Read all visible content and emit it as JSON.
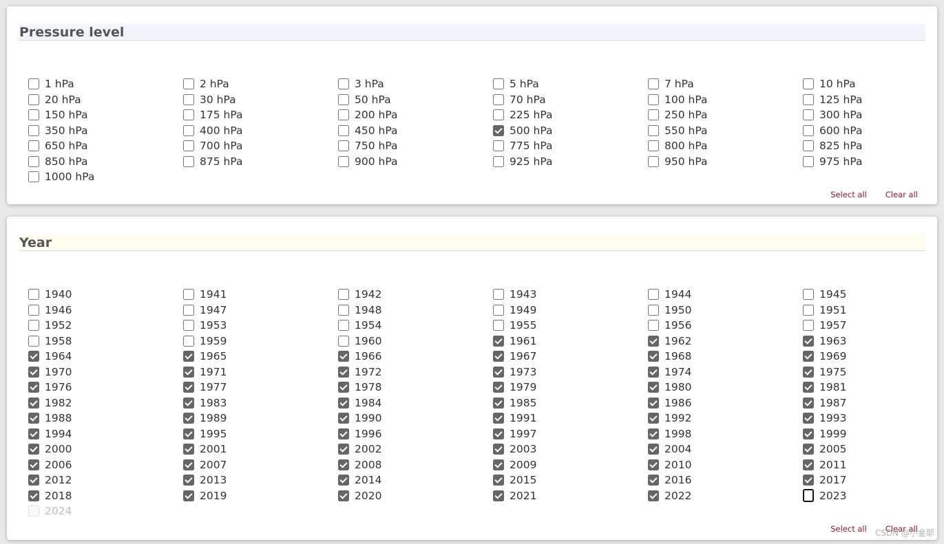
{
  "pressure": {
    "title": "Pressure level",
    "options": [
      {
        "label": "1 hPa",
        "checked": false
      },
      {
        "label": "2 hPa",
        "checked": false
      },
      {
        "label": "3 hPa",
        "checked": false
      },
      {
        "label": "5 hPa",
        "checked": false
      },
      {
        "label": "7 hPa",
        "checked": false
      },
      {
        "label": "10 hPa",
        "checked": false
      },
      {
        "label": "20 hPa",
        "checked": false
      },
      {
        "label": "30 hPa",
        "checked": false
      },
      {
        "label": "50 hPa",
        "checked": false
      },
      {
        "label": "70 hPa",
        "checked": false
      },
      {
        "label": "100 hPa",
        "checked": false
      },
      {
        "label": "125 hPa",
        "checked": false
      },
      {
        "label": "150 hPa",
        "checked": false
      },
      {
        "label": "175 hPa",
        "checked": false
      },
      {
        "label": "200 hPa",
        "checked": false
      },
      {
        "label": "225 hPa",
        "checked": false
      },
      {
        "label": "250 hPa",
        "checked": false
      },
      {
        "label": "300 hPa",
        "checked": false
      },
      {
        "label": "350 hPa",
        "checked": false
      },
      {
        "label": "400 hPa",
        "checked": false
      },
      {
        "label": "450 hPa",
        "checked": false
      },
      {
        "label": "500 hPa",
        "checked": true
      },
      {
        "label": "550 hPa",
        "checked": false
      },
      {
        "label": "600 hPa",
        "checked": false
      },
      {
        "label": "650 hPa",
        "checked": false
      },
      {
        "label": "700 hPa",
        "checked": false
      },
      {
        "label": "750 hPa",
        "checked": false
      },
      {
        "label": "775 hPa",
        "checked": false
      },
      {
        "label": "800 hPa",
        "checked": false
      },
      {
        "label": "825 hPa",
        "checked": false
      },
      {
        "label": "850 hPa",
        "checked": false
      },
      {
        "label": "875 hPa",
        "checked": false
      },
      {
        "label": "900 hPa",
        "checked": false
      },
      {
        "label": "925 hPa",
        "checked": false
      },
      {
        "label": "950 hPa",
        "checked": false
      },
      {
        "label": "975 hPa",
        "checked": false
      },
      {
        "label": "1000 hPa",
        "checked": false
      }
    ],
    "select_all": "Select all",
    "clear_all": "Clear all"
  },
  "year": {
    "title": "Year",
    "options": [
      {
        "label": "1940",
        "checked": false
      },
      {
        "label": "1941",
        "checked": false
      },
      {
        "label": "1942",
        "checked": false
      },
      {
        "label": "1943",
        "checked": false
      },
      {
        "label": "1944",
        "checked": false
      },
      {
        "label": "1945",
        "checked": false
      },
      {
        "label": "1946",
        "checked": false
      },
      {
        "label": "1947",
        "checked": false
      },
      {
        "label": "1948",
        "checked": false
      },
      {
        "label": "1949",
        "checked": false
      },
      {
        "label": "1950",
        "checked": false
      },
      {
        "label": "1951",
        "checked": false
      },
      {
        "label": "1952",
        "checked": false
      },
      {
        "label": "1953",
        "checked": false
      },
      {
        "label": "1954",
        "checked": false
      },
      {
        "label": "1955",
        "checked": false
      },
      {
        "label": "1956",
        "checked": false
      },
      {
        "label": "1957",
        "checked": false
      },
      {
        "label": "1958",
        "checked": false
      },
      {
        "label": "1959",
        "checked": false
      },
      {
        "label": "1960",
        "checked": false
      },
      {
        "label": "1961",
        "checked": true
      },
      {
        "label": "1962",
        "checked": true
      },
      {
        "label": "1963",
        "checked": true
      },
      {
        "label": "1964",
        "checked": true
      },
      {
        "label": "1965",
        "checked": true
      },
      {
        "label": "1966",
        "checked": true
      },
      {
        "label": "1967",
        "checked": true
      },
      {
        "label": "1968",
        "checked": true
      },
      {
        "label": "1969",
        "checked": true
      },
      {
        "label": "1970",
        "checked": true
      },
      {
        "label": "1971",
        "checked": true
      },
      {
        "label": "1972",
        "checked": true
      },
      {
        "label": "1973",
        "checked": true
      },
      {
        "label": "1974",
        "checked": true
      },
      {
        "label": "1975",
        "checked": true
      },
      {
        "label": "1976",
        "checked": true
      },
      {
        "label": "1977",
        "checked": true
      },
      {
        "label": "1978",
        "checked": true
      },
      {
        "label": "1979",
        "checked": true
      },
      {
        "label": "1980",
        "checked": true
      },
      {
        "label": "1981",
        "checked": true
      },
      {
        "label": "1982",
        "checked": true
      },
      {
        "label": "1983",
        "checked": true
      },
      {
        "label": "1984",
        "checked": true
      },
      {
        "label": "1985",
        "checked": true
      },
      {
        "label": "1986",
        "checked": true
      },
      {
        "label": "1987",
        "checked": true
      },
      {
        "label": "1988",
        "checked": true
      },
      {
        "label": "1989",
        "checked": true
      },
      {
        "label": "1990",
        "checked": true
      },
      {
        "label": "1991",
        "checked": true
      },
      {
        "label": "1992",
        "checked": true
      },
      {
        "label": "1993",
        "checked": true
      },
      {
        "label": "1994",
        "checked": true
      },
      {
        "label": "1995",
        "checked": true
      },
      {
        "label": "1996",
        "checked": true
      },
      {
        "label": "1997",
        "checked": true
      },
      {
        "label": "1998",
        "checked": true
      },
      {
        "label": "1999",
        "checked": true
      },
      {
        "label": "2000",
        "checked": true
      },
      {
        "label": "2001",
        "checked": true
      },
      {
        "label": "2002",
        "checked": true
      },
      {
        "label": "2003",
        "checked": true
      },
      {
        "label": "2004",
        "checked": true
      },
      {
        "label": "2005",
        "checked": true
      },
      {
        "label": "2006",
        "checked": true
      },
      {
        "label": "2007",
        "checked": true
      },
      {
        "label": "2008",
        "checked": true
      },
      {
        "label": "2009",
        "checked": true
      },
      {
        "label": "2010",
        "checked": true
      },
      {
        "label": "2011",
        "checked": true
      },
      {
        "label": "2012",
        "checked": true
      },
      {
        "label": "2013",
        "checked": true
      },
      {
        "label": "2014",
        "checked": true
      },
      {
        "label": "2015",
        "checked": true
      },
      {
        "label": "2016",
        "checked": true
      },
      {
        "label": "2017",
        "checked": true
      },
      {
        "label": "2018",
        "checked": true
      },
      {
        "label": "2019",
        "checked": true
      },
      {
        "label": "2020",
        "checked": true
      },
      {
        "label": "2021",
        "checked": true
      },
      {
        "label": "2022",
        "checked": true
      },
      {
        "label": "2023",
        "checked": false,
        "focused": true
      },
      {
        "label": "2024",
        "checked": false,
        "disabled": true
      }
    ],
    "select_all": "Select all",
    "clear_all": "Clear all"
  },
  "watermark": "CSDN @小金耶",
  "colors": {
    "action_link": "#8b1a2b",
    "checkbox_checked": "#666666",
    "pressure_header_bg": "#f3f5fc",
    "year_header_bg": "#fefdf0"
  }
}
